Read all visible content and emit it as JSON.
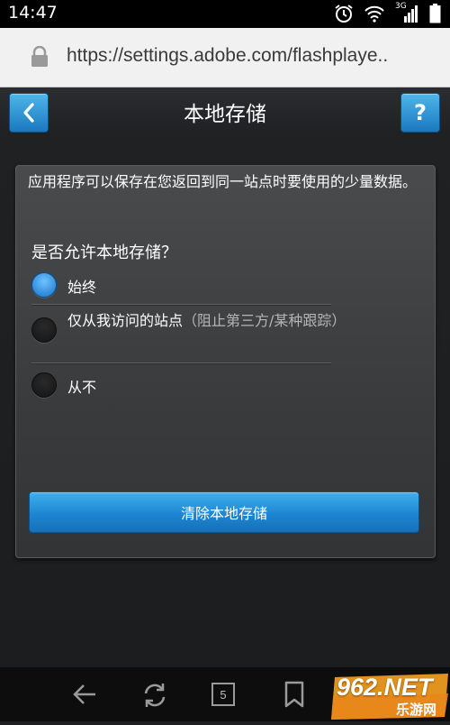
{
  "status_bar": {
    "time": "14:47",
    "network": "3G"
  },
  "url_bar": {
    "url": "https://settings.adobe.com/flashplaye.."
  },
  "header": {
    "title": "本地存储",
    "help_label": "?"
  },
  "panel": {
    "description": "应用程序可以保存在您返回到同一站点时要使用的少量数据。",
    "question": "是否允许本地存储？",
    "options": [
      {
        "label": "始终",
        "sub": "",
        "selected": true
      },
      {
        "label": "仅从我访问的站点",
        "sub": "（阻止第三方/某种跟踪）",
        "selected": false
      },
      {
        "label": "从不",
        "sub": "",
        "selected": false
      }
    ],
    "clear_button": "清除本地存储"
  },
  "bottom_nav": {
    "tab_count": "5"
  },
  "watermark": {
    "brand": "962.NET",
    "sub": "乐游网"
  },
  "colors": {
    "accent": "#1d86d2",
    "panel": "#3a3b3d",
    "page_bg": "#1d1f21"
  }
}
